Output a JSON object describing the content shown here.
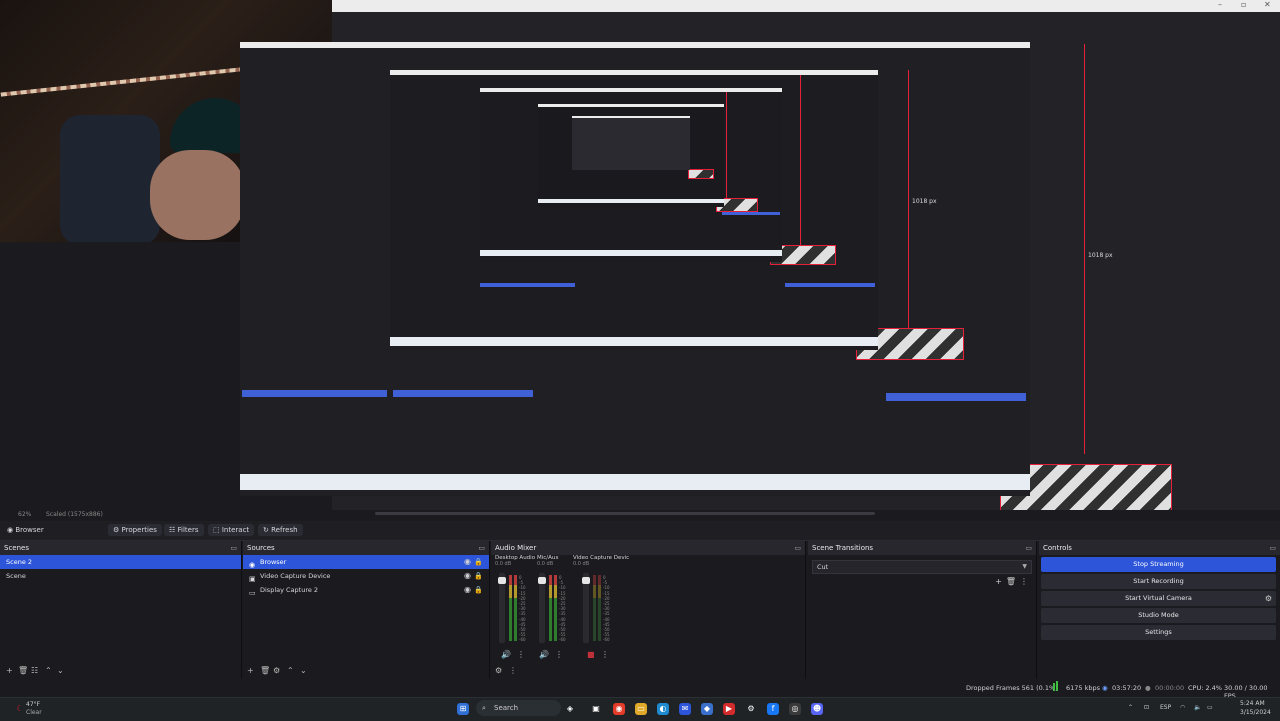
{
  "preview": {
    "dimension_label_large": "1018 px",
    "dimension_label_small": "1018 px",
    "status_zoom": "62%",
    "status_scaled": "Scaled (1575x886)"
  },
  "webcam": {
    "label": "Webcam overlay"
  },
  "context_bar": {
    "source_name": "Browser",
    "properties_label": "Properties",
    "filters_label": "Filters",
    "interact_label": "Interact",
    "refresh_label": "Refresh"
  },
  "scenes": {
    "title": "Scenes",
    "items": [
      {
        "label": "Scene 2",
        "selected": true
      },
      {
        "label": "Scene",
        "selected": false
      }
    ]
  },
  "sources": {
    "title": "Sources",
    "items": [
      {
        "label": "Browser",
        "icon": "globe-icon",
        "selected": true
      },
      {
        "label": "Video Capture Device",
        "icon": "camera-icon",
        "selected": false
      },
      {
        "label": "Display Capture 2",
        "icon": "monitor-icon",
        "selected": false
      }
    ]
  },
  "audio_mixer": {
    "title": "Audio Mixer",
    "channels": [
      {
        "name": "Desktop Audio",
        "db": "0.0 dB"
      },
      {
        "name": "Mic/Aux",
        "db": "0.0 dB"
      },
      {
        "name": "Video Capture Devic",
        "db": "0.0 dB"
      }
    ],
    "ticks": [
      "0",
      "-5",
      "-10",
      "-15",
      "-20",
      "-25",
      "-30",
      "-35",
      "-40",
      "-45",
      "-50",
      "-55",
      "-60"
    ]
  },
  "scene_transitions": {
    "title": "Scene Transitions",
    "selected": "Cut"
  },
  "controls": {
    "title": "Controls",
    "stop_streaming": "Stop Streaming",
    "start_recording": "Start Recording",
    "start_virtual_camera": "Start Virtual Camera",
    "studio_mode": "Studio Mode",
    "settings": "Settings"
  },
  "status": {
    "dropped_frames": "Dropped Frames 561 (0.1%)",
    "bitrate": "6175 kbps",
    "stream_time": "03:57:20",
    "rec_time": "00:00:00",
    "cpu": "CPU: 2.4%",
    "fps": "30.00 / 30.00 FPS"
  },
  "taskbar": {
    "weather_temp": "47°F",
    "weather_desc": "Clear",
    "search_placeholder": "Search",
    "language": "ESP",
    "time": "5:24 AM",
    "date": "3/15/2024"
  },
  "colors": {
    "accent": "#2c55d9",
    "panel": "#1b1b1f",
    "header": "#27272d",
    "danger": "#e5203a"
  }
}
